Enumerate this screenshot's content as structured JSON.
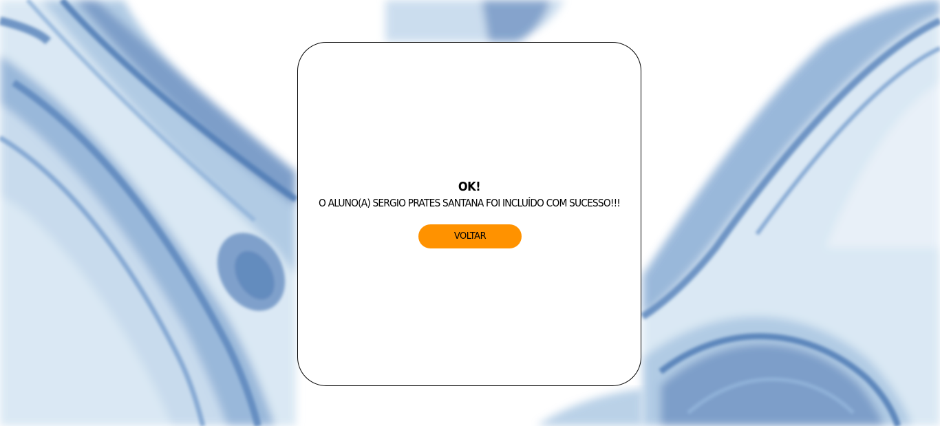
{
  "colors": {
    "accent": "#ff9200",
    "card_bg": "#ffffff",
    "card_border": "#000000",
    "watercolor_dark": "#5d87bd",
    "watercolor_mid": "#9fbfdd",
    "watercolor_light": "#d6e6f3"
  },
  "dialog": {
    "title": "OK!",
    "message": "O ALUNO(A) SERGIO PRATES SANTANA FOI INCLUÍDO COM SUCESSO!!!",
    "button_label": "VOLTAR"
  }
}
